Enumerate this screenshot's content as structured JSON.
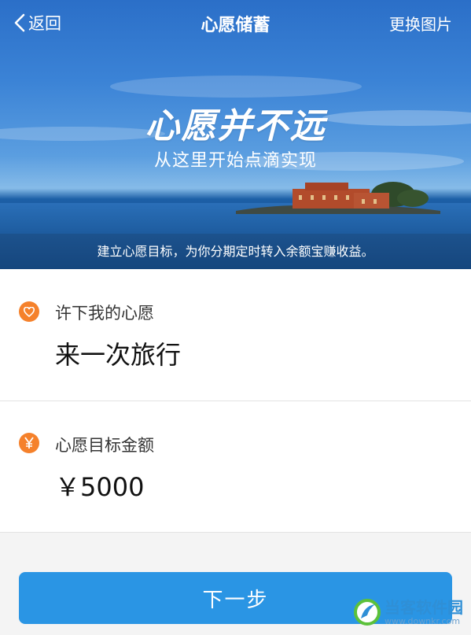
{
  "nav": {
    "back_label": "返回",
    "title": "心愿储蓄",
    "change_image_label": "更换图片"
  },
  "hero": {
    "slogan_main": "心愿并不远",
    "slogan_sub": "从这里开始点滴实现",
    "description": "建立心愿目标，为你分期定时转入余额宝赚收益。"
  },
  "wish": {
    "label": "许下我的心愿",
    "value": "来一次旅行",
    "icon": "heart-icon"
  },
  "amount": {
    "label": "心愿目标金额",
    "value": "￥5000",
    "icon": "yen-icon"
  },
  "next_button": {
    "label": "下一步"
  },
  "watermark": {
    "main": "当客软件园",
    "sub": "www.downkr.com"
  },
  "colors": {
    "accent_blue": "#2a95e4",
    "icon_orange": "#f5812b"
  }
}
